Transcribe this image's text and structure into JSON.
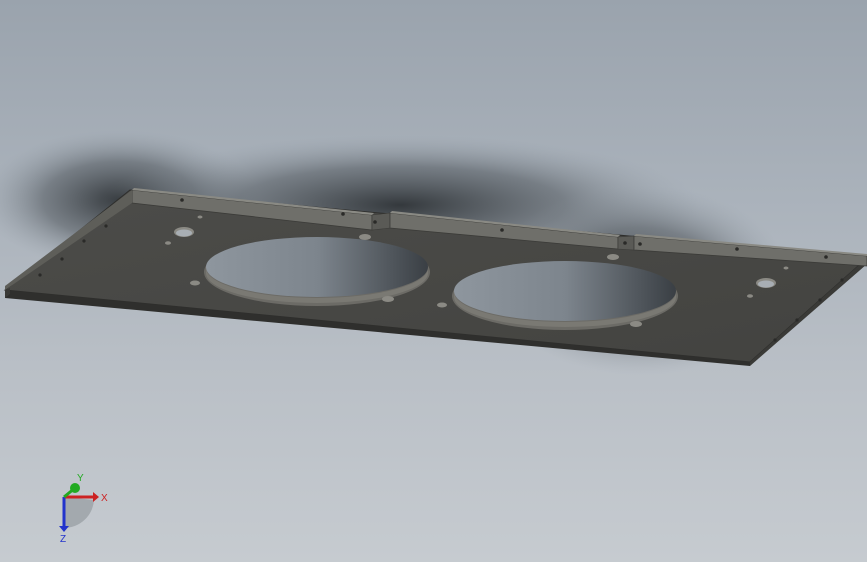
{
  "viewport": {
    "background_top": "#9aa3ad",
    "background_bottom": "#c6cbd0"
  },
  "model": {
    "plate_color": "#4a4a47",
    "edge_color": "#2e2e2c",
    "flange_color": "#6b6b66",
    "hole_wall_color": "#6f6e69"
  },
  "triad": {
    "x_label": "X",
    "y_label": "Y",
    "z_label": "Z",
    "x_color": "#cc2222",
    "y_color": "#22aa22",
    "z_color": "#2233cc"
  }
}
